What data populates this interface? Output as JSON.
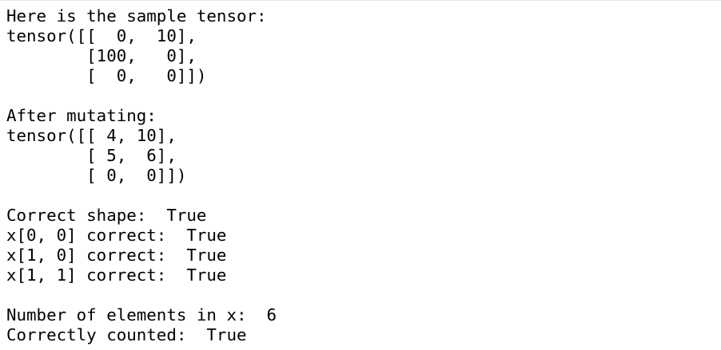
{
  "output": {
    "lines": [
      "Here is the sample tensor:",
      "tensor([[  0,  10],",
      "        [100,   0],",
      "        [  0,   0]])",
      "",
      "After mutating:",
      "tensor([[ 4, 10],",
      "        [ 5,  6],",
      "        [ 0,  0]])",
      "",
      "Correct shape:  True",
      "x[0, 0] correct:  True",
      "x[1, 0] correct:  True",
      "x[1, 1] correct:  True",
      "",
      "Number of elements in x:  6",
      "Correctly counted:  True"
    ]
  }
}
